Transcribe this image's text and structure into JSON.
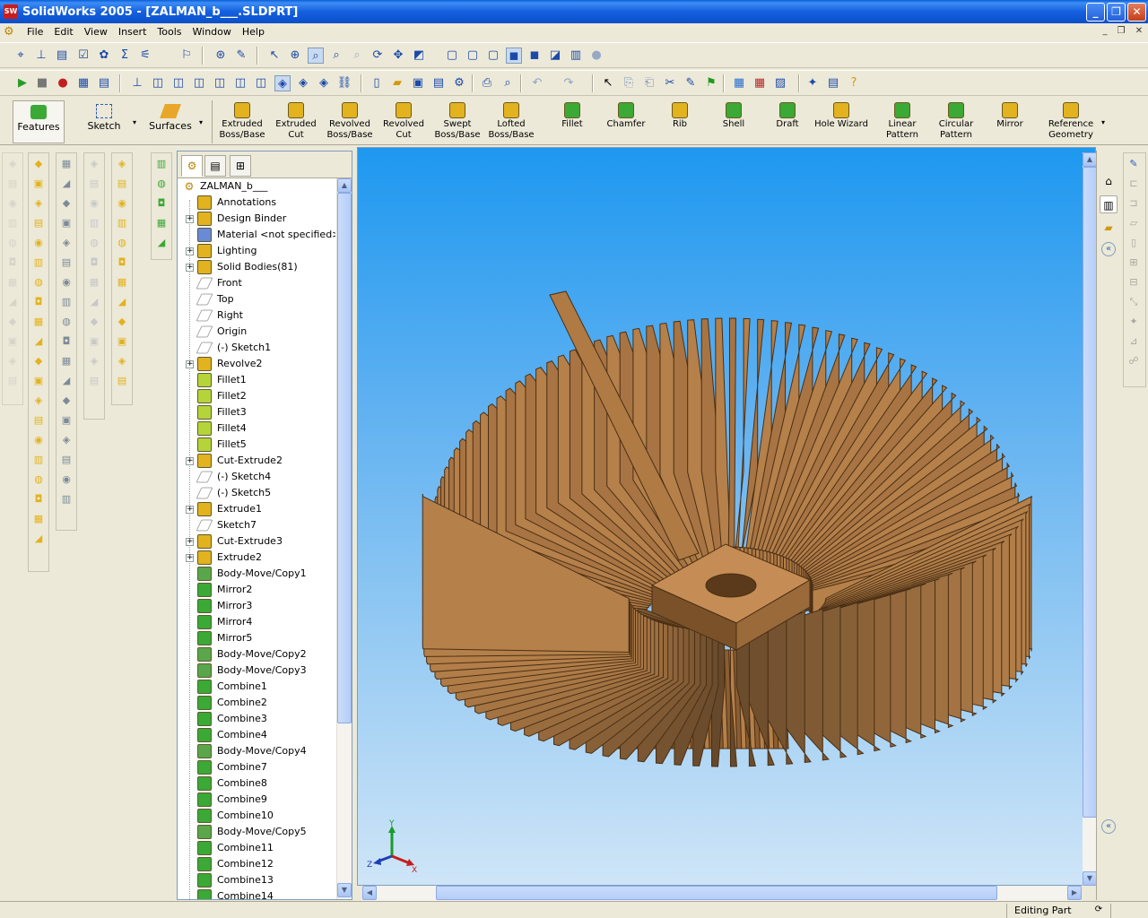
{
  "window": {
    "title": "SolidWorks 2005 - [ZALMAN_b___.SLDPRT]",
    "app_badge": "SW"
  },
  "menu": [
    "File",
    "Edit",
    "View",
    "Insert",
    "Tools",
    "Window",
    "Help"
  ],
  "command_manager": {
    "tabs": [
      {
        "label": "Features"
      },
      {
        "label": "Sketch"
      },
      {
        "label": "Surfaces"
      }
    ],
    "buttons": [
      {
        "line1": "Extruded",
        "line2": "Boss/Base",
        "color": "#e2b21f"
      },
      {
        "line1": "Extruded",
        "line2": "Cut",
        "color": "#e2b21f"
      },
      {
        "line1": "Revolved",
        "line2": "Boss/Base",
        "color": "#e2b21f"
      },
      {
        "line1": "Revolved",
        "line2": "Cut",
        "color": "#e2b21f"
      },
      {
        "line1": "Swept",
        "line2": "Boss/Base",
        "color": "#e2b21f"
      },
      {
        "line1": "Lofted",
        "line2": "Boss/Base",
        "color": "#e2b21f"
      },
      {
        "line1": "Fillet",
        "line2": "",
        "color": "#3aa935"
      },
      {
        "line1": "Chamfer",
        "line2": "",
        "color": "#3aa935"
      },
      {
        "line1": "Rib",
        "line2": "",
        "color": "#e2b21f"
      },
      {
        "line1": "Shell",
        "line2": "",
        "color": "#3aa935"
      },
      {
        "line1": "Draft",
        "line2": "",
        "color": "#3aa935"
      },
      {
        "line1": "Hole Wizard",
        "line2": "",
        "color": "#e2b21f"
      },
      {
        "line1": "Linear",
        "line2": "Pattern",
        "color": "#3aa935"
      },
      {
        "line1": "Circular",
        "line2": "Pattern",
        "color": "#3aa935"
      },
      {
        "line1": "Mirror",
        "line2": "",
        "color": "#e2b21f"
      },
      {
        "line1": "Reference",
        "line2": "Geometry",
        "color": "#e2b21f"
      }
    ]
  },
  "feature_tree": {
    "root": "ZALMAN_b___",
    "items": [
      {
        "label": "Annotations",
        "icon": "annotations-icon",
        "expandable": false,
        "color": "#e2b21f"
      },
      {
        "label": "Design Binder",
        "icon": "design-binder-icon",
        "expandable": true,
        "color": "#e2b21f"
      },
      {
        "label": "Material <not specified>",
        "icon": "material-icon",
        "expandable": false,
        "color": "#6b8ad6"
      },
      {
        "label": "Lighting",
        "icon": "lighting-icon",
        "expandable": true,
        "color": "#e2b21f"
      },
      {
        "label": "Solid Bodies(81)",
        "icon": "solid-bodies-icon",
        "expandable": true,
        "color": "#e2b21f"
      },
      {
        "label": "Front",
        "icon": "plane-icon",
        "expandable": false,
        "color": "#ffffff"
      },
      {
        "label": "Top",
        "icon": "plane-icon",
        "expandable": false,
        "color": "#ffffff"
      },
      {
        "label": "Right",
        "icon": "plane-icon",
        "expandable": false,
        "color": "#ffffff"
      },
      {
        "label": "Origin",
        "icon": "origin-icon",
        "expandable": false,
        "color": "#ffffff"
      },
      {
        "label": "(-) Sketch1",
        "icon": "sketch-icon",
        "expandable": false,
        "color": "#ffffff"
      },
      {
        "label": "Revolve2",
        "icon": "revolve-icon",
        "expandable": true,
        "color": "#e2b21f"
      },
      {
        "label": "Fillet1",
        "icon": "fillet-icon",
        "expandable": false,
        "color": "#b5d43a"
      },
      {
        "label": "Fillet2",
        "icon": "fillet-icon",
        "expandable": false,
        "color": "#b5d43a"
      },
      {
        "label": "Fillet3",
        "icon": "fillet-icon",
        "expandable": false,
        "color": "#b5d43a"
      },
      {
        "label": "Fillet4",
        "icon": "fillet-icon",
        "expandable": false,
        "color": "#b5d43a"
      },
      {
        "label": "Fillet5",
        "icon": "fillet-icon",
        "expandable": false,
        "color": "#b5d43a"
      },
      {
        "label": "Cut-Extrude2",
        "icon": "cut-extrude-icon",
        "expandable": true,
        "color": "#e2b21f"
      },
      {
        "label": "(-) Sketch4",
        "icon": "sketch-icon",
        "expandable": false,
        "color": "#ffffff"
      },
      {
        "label": "(-) Sketch5",
        "icon": "sketch-icon",
        "expandable": false,
        "color": "#ffffff"
      },
      {
        "label": "Extrude1",
        "icon": "extrude-icon",
        "expandable": true,
        "color": "#e2b21f"
      },
      {
        "label": "Sketch7",
        "icon": "sketch-icon",
        "expandable": false,
        "color": "#ffffff"
      },
      {
        "label": "Cut-Extrude3",
        "icon": "cut-extrude-icon",
        "expandable": true,
        "color": "#e2b21f"
      },
      {
        "label": "Extrude2",
        "icon": "extrude-icon",
        "expandable": true,
        "color": "#e2b21f"
      },
      {
        "label": "Body-Move/Copy1",
        "icon": "body-move-icon",
        "expandable": false,
        "color": "#5aa64a"
      },
      {
        "label": "Mirror2",
        "icon": "mirror-icon",
        "expandable": false,
        "color": "#3aa935"
      },
      {
        "label": "Mirror3",
        "icon": "mirror-icon",
        "expandable": false,
        "color": "#3aa935"
      },
      {
        "label": "Mirror4",
        "icon": "mirror-icon",
        "expandable": false,
        "color": "#3aa935"
      },
      {
        "label": "Mirror5",
        "icon": "mirror-icon",
        "expandable": false,
        "color": "#3aa935"
      },
      {
        "label": "Body-Move/Copy2",
        "icon": "body-move-icon",
        "expandable": false,
        "color": "#5aa64a"
      },
      {
        "label": "Body-Move/Copy3",
        "icon": "body-move-icon",
        "expandable": false,
        "color": "#5aa64a"
      },
      {
        "label": "Combine1",
        "icon": "combine-icon",
        "expandable": false,
        "color": "#3aa935"
      },
      {
        "label": "Combine2",
        "icon": "combine-icon",
        "expandable": false,
        "color": "#3aa935"
      },
      {
        "label": "Combine3",
        "icon": "combine-icon",
        "expandable": false,
        "color": "#3aa935"
      },
      {
        "label": "Combine4",
        "icon": "combine-icon",
        "expandable": false,
        "color": "#3aa935"
      },
      {
        "label": "Body-Move/Copy4",
        "icon": "body-move-icon",
        "expandable": false,
        "color": "#5aa64a"
      },
      {
        "label": "Combine7",
        "icon": "combine-icon",
        "expandable": false,
        "color": "#3aa935"
      },
      {
        "label": "Combine8",
        "icon": "combine-icon",
        "expandable": false,
        "color": "#3aa935"
      },
      {
        "label": "Combine9",
        "icon": "combine-icon",
        "expandable": false,
        "color": "#3aa935"
      },
      {
        "label": "Combine10",
        "icon": "combine-icon",
        "expandable": false,
        "color": "#3aa935"
      },
      {
        "label": "Body-Move/Copy5",
        "icon": "body-move-icon",
        "expandable": false,
        "color": "#5aa64a"
      },
      {
        "label": "Combine11",
        "icon": "combine-icon",
        "expandable": false,
        "color": "#3aa935"
      },
      {
        "label": "Combine12",
        "icon": "combine-icon",
        "expandable": false,
        "color": "#3aa935"
      },
      {
        "label": "Combine13",
        "icon": "combine-icon",
        "expandable": false,
        "color": "#3aa935"
      },
      {
        "label": "Combine14",
        "icon": "combine-icon",
        "expandable": false,
        "color": "#3aa935"
      }
    ]
  },
  "triad": {
    "x": "X",
    "y": "Y",
    "z": "Z"
  },
  "model": {
    "color": "#b5804a",
    "dark": "#4a2f14"
  },
  "status": {
    "mode": "Editing Part"
  }
}
